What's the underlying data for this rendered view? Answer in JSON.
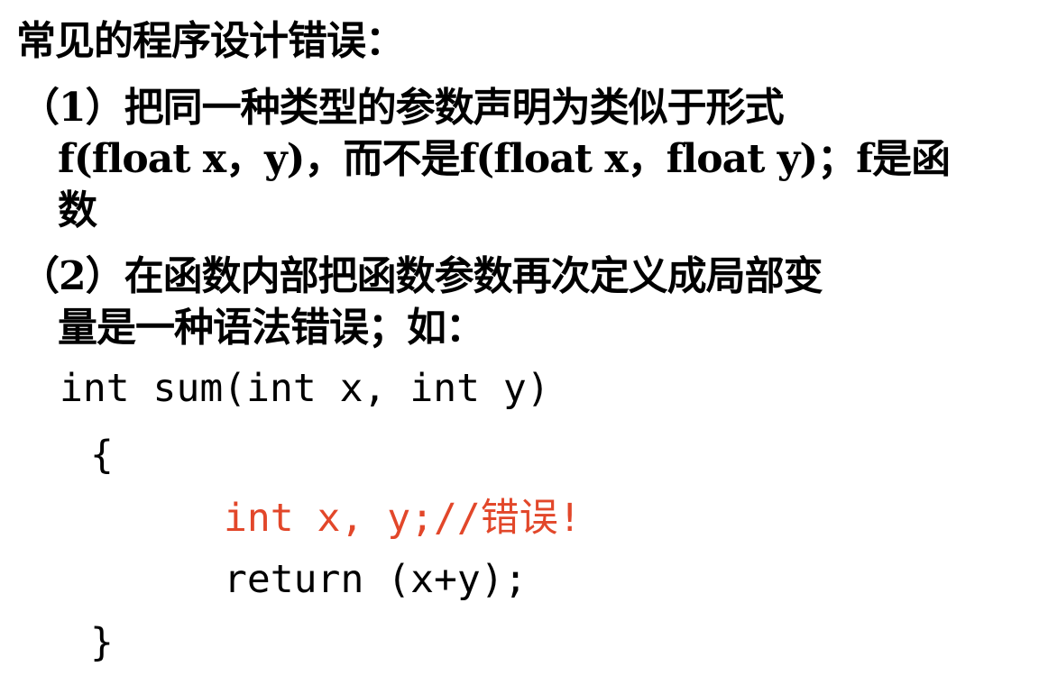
{
  "title": "常见的程序设计错误：",
  "item1": {
    "line1": "（1）把同一种类型的参数声明为类似于形式",
    "line2": "f(float x，y)，而不是f(float x，float y)；f是函",
    "line3": "数"
  },
  "item2": {
    "line1": "（2）在函数内部把函数参数再次定义成局部变",
    "line2": "量是一种语法错误；如："
  },
  "code": {
    "line1": "int sum(int x, int y)",
    "line2": "{",
    "line3": "int x, y;//错误!",
    "line4": "return (x+y);",
    "line5": "}"
  },
  "colors": {
    "text": "#000000",
    "error": "#e2472a"
  }
}
